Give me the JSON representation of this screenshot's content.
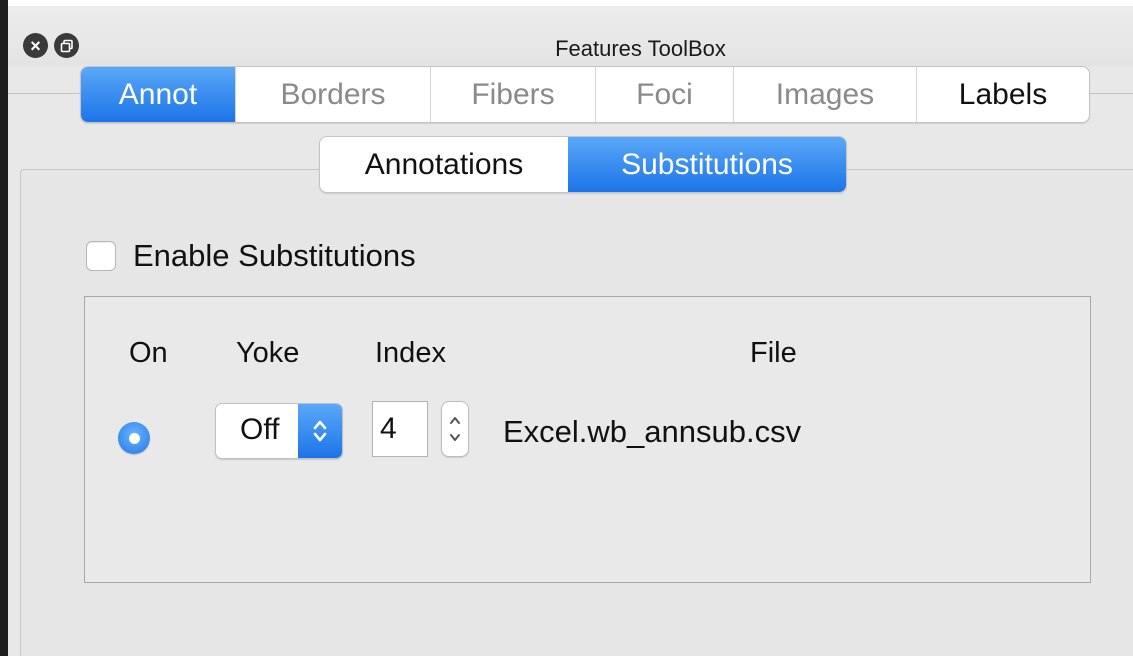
{
  "window": {
    "title": "Features ToolBox",
    "close_icon": "close-icon",
    "restore_icon": "restore-icon"
  },
  "tabs": [
    {
      "label": "Annot",
      "state": "active"
    },
    {
      "label": "Borders",
      "state": "disabled"
    },
    {
      "label": "Fibers",
      "state": "disabled"
    },
    {
      "label": "Foci",
      "state": "disabled"
    },
    {
      "label": "Images",
      "state": "disabled"
    },
    {
      "label": "Labels",
      "state": "normal"
    }
  ],
  "subtabs": [
    {
      "label": "Annotations",
      "state": "normal"
    },
    {
      "label": "Substitutions",
      "state": "active"
    }
  ],
  "enable": {
    "label": "Enable Substitutions",
    "checked": false
  },
  "table": {
    "headers": {
      "on": "On",
      "yoke": "Yoke",
      "index": "Index",
      "file": "File"
    },
    "row": {
      "on": true,
      "yoke": "Off",
      "index": "4",
      "file": "Excel.wb_annsub.csv"
    }
  },
  "colors": {
    "accent": "#1c74e8",
    "accent_light": "#5aa8f8",
    "background": "#e8e8e8",
    "disabled_text": "#8a8a8a"
  }
}
